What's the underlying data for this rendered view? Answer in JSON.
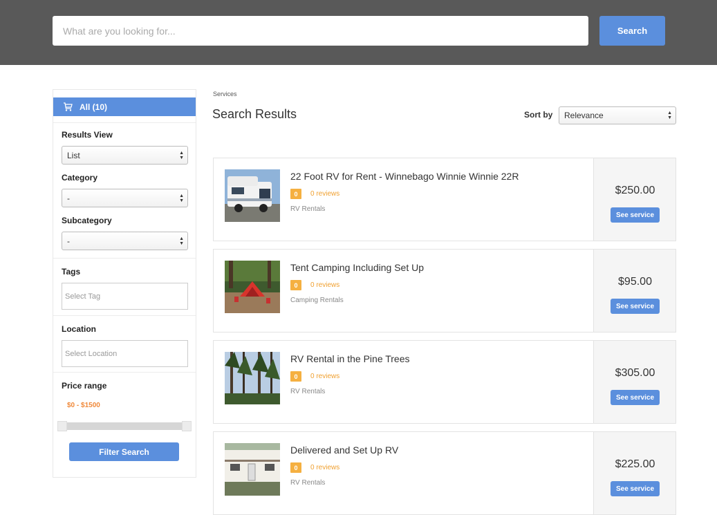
{
  "search": {
    "placeholder": "What are you looking for...",
    "button_label": "Search"
  },
  "sidebar": {
    "all_label": "All (10)",
    "results_view": {
      "label": "Results View",
      "value": "List"
    },
    "category": {
      "label": "Category",
      "value": "-"
    },
    "subcategory": {
      "label": "Subcategory",
      "value": "-"
    },
    "tags": {
      "label": "Tags",
      "placeholder": "Select Tag"
    },
    "location": {
      "label": "Location",
      "placeholder": "Select Location"
    },
    "price_range": {
      "label": "Price range",
      "value": "$0 - $1500",
      "min": 0,
      "max": 1500
    },
    "filter_button": "Filter Search"
  },
  "main": {
    "breadcrumb": "Services",
    "title": "Search Results",
    "sort": {
      "label": "Sort by",
      "value": "Relevance"
    },
    "results": [
      {
        "title": "22 Foot RV for Rent - Winnebago Winnie Winnie 22R",
        "rating": "0",
        "reviews": "0 reviews",
        "category": "RV Rentals",
        "price": "$250.00",
        "button": "See service",
        "image": "rv-photo"
      },
      {
        "title": "Tent Camping Including Set Up",
        "rating": "0",
        "reviews": "0 reviews",
        "category": "Camping Rentals",
        "price": "$95.00",
        "button": "See service",
        "image": "tent-photo"
      },
      {
        "title": "RV Rental in the Pine Trees",
        "rating": "0",
        "reviews": "0 reviews",
        "category": "RV Rentals",
        "price": "$305.00",
        "button": "See service",
        "image": "pine-trees-photo"
      },
      {
        "title": "Delivered and Set Up RV",
        "rating": "0",
        "reviews": "0 reviews",
        "category": "RV Rentals",
        "price": "$225.00",
        "button": "See service",
        "image": "trailer-photo"
      }
    ]
  },
  "icons": {
    "all": "cart-icon",
    "select_arrows": "updown-arrows-icon"
  },
  "colors": {
    "primary": "#5b8fdd",
    "header": "#595959",
    "accent_orange": "#f0893a",
    "badge": "#f5b041"
  }
}
